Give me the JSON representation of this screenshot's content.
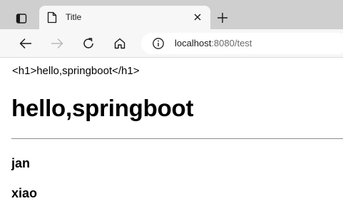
{
  "browser": {
    "tab": {
      "title": "Title"
    },
    "address_bar": {
      "host": "localhost",
      "rest": ":8080/test"
    }
  },
  "page": {
    "escaped_text": "<h1>hello,springboot</h1>",
    "heading": "hello,springboot",
    "items": [
      "jan",
      "xiao"
    ]
  },
  "icons": {
    "tab_actions": "tab-actions-icon",
    "page": "page-icon",
    "close": "close-icon",
    "new_tab": "plus-icon",
    "back": "back-arrow-icon",
    "forward": "forward-arrow-icon",
    "refresh": "refresh-icon",
    "home": "home-icon",
    "site_info": "info-icon"
  },
  "colors": {
    "tabstrip_bg": "#cfcfcf",
    "toolbar_bg": "#f7f7f7",
    "forward_disabled": "#b9b9b9"
  }
}
